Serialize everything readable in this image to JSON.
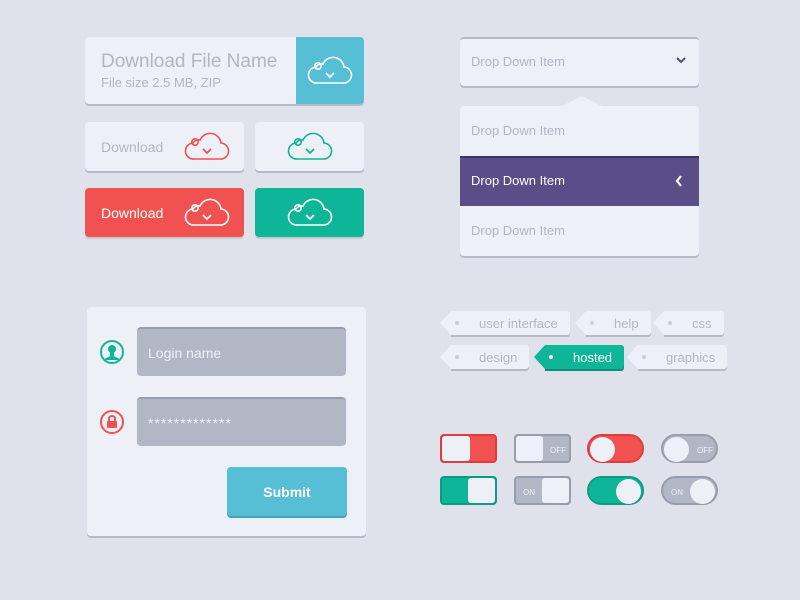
{
  "colors": {
    "background": "#dfe2ea",
    "card": "#eef0f8",
    "accent_blue": "#56bfd6",
    "accent_red": "#f25151",
    "accent_green": "#0fb597",
    "accent_purple": "#594e87",
    "muted_text": "#b2b6c2",
    "input_bg": "#b1b7c4"
  },
  "file_download": {
    "title": "Download File Name",
    "meta": "File size  2.5 MB, ZIP",
    "icon": "cloud-download-icon"
  },
  "buttons": {
    "download_light_label": "Download",
    "download_red_label": "Download",
    "icon": "cloud-download-icon"
  },
  "dropdown": {
    "selected": "Drop Down Item",
    "items": [
      {
        "label": "Drop Down Item",
        "active": false
      },
      {
        "label": "Drop Down Item",
        "active": true
      },
      {
        "label": "Drop Down Item",
        "active": false
      }
    ]
  },
  "login": {
    "username_placeholder": "Login name",
    "password_value": "*************",
    "submit_label": "Submit",
    "user_icon": "user-icon",
    "lock_icon": "lock-icon"
  },
  "tags": [
    {
      "label": "user interface",
      "active": false
    },
    {
      "label": "help",
      "active": false
    },
    {
      "label": "css",
      "active": false
    },
    {
      "label": "design",
      "active": false
    },
    {
      "label": "hosted",
      "active": true
    },
    {
      "label": "graphics",
      "active": false
    }
  ],
  "toggles": {
    "off_label": "OFF",
    "on_label": "ON",
    "states": [
      {
        "style": "square-red",
        "on": false
      },
      {
        "style": "square-gray",
        "on": false
      },
      {
        "style": "round-red",
        "on": false
      },
      {
        "style": "round-gray",
        "on": false
      },
      {
        "style": "square-green",
        "on": true
      },
      {
        "style": "square-gray",
        "on": true
      },
      {
        "style": "round-green",
        "on": true
      },
      {
        "style": "round-gray",
        "on": true
      }
    ]
  }
}
